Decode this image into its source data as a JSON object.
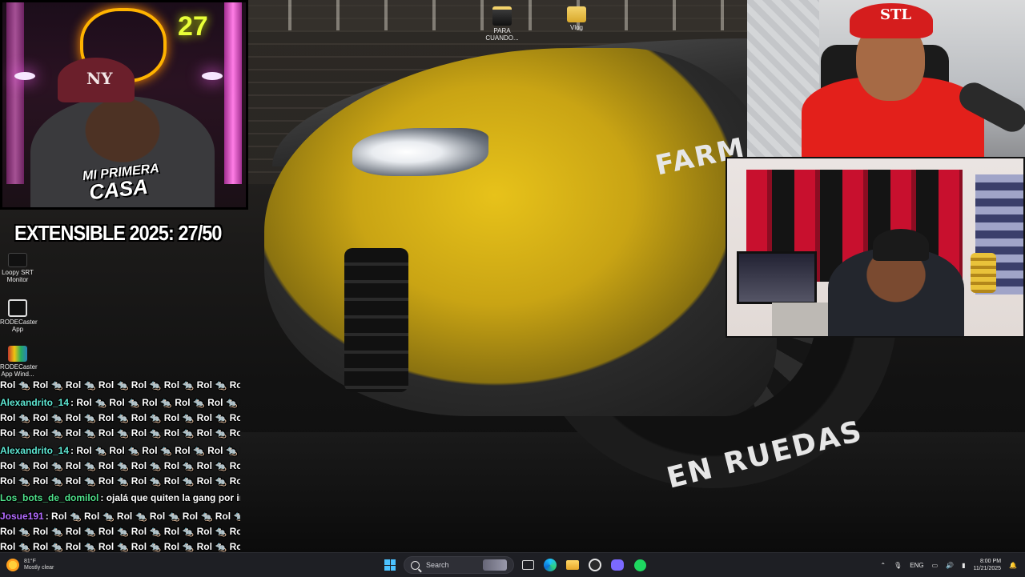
{
  "desktop": {
    "icons": [
      {
        "label": "PARA CUANDO..."
      },
      {
        "label": "Vlog"
      },
      {
        "label": "Loopy SRT Monitor"
      },
      {
        "label": "RODECaster App"
      },
      {
        "label": "RODECaster App Wind..."
      }
    ]
  },
  "overlay": {
    "brand_line1": "MI PRIMERA",
    "brand_line2": "CASA",
    "counter": "EXTENSIBLE 2025: 27/50",
    "cam1_neon": "27",
    "cam1_cap_logo": "NY",
    "cam2_cap_logo": "STL"
  },
  "scene": {
    "tire_top_text": "FARM",
    "tire_bottom_text": "EN RUEDAS"
  },
  "chat": {
    "lines": [
      {
        "user": "",
        "message": "Rol 🐀 Rol 🐀 Rol 🐀 Rol 🐀 Rol 🐀 Rol 🐀 Rol 🐀 Rol 🐀 Ro",
        "color": "#ffffff"
      },
      {
        "user": "Alexandrito_14",
        "message": ": Rol 🐀 Rol 🐀 Rol 🐀 Rol 🐀 Rol 🐀 Rol 🐀 Rol",
        "color": "#5ee6d2"
      },
      {
        "user": "",
        "message": "Rol 🐀 Rol 🐀 Rol 🐀 Rol 🐀 Rol 🐀 Rol 🐀 Rol 🐀 Rol 🐀 Ro",
        "color": "#ffffff"
      },
      {
        "user": "",
        "message": "Rol 🐀 Rol 🐀 Rol 🐀 Rol 🐀 Rol 🐀 Rol 🐀 Rol 🐀 Rol 🐀 Ro",
        "color": "#ffffff"
      },
      {
        "user": "Alexandrito_14",
        "message": ": Rol 🐀 Rol 🐀 Rol 🐀 Rol 🐀 Rol 🐀 Rol 🐀 Rol",
        "color": "#5ee6d2"
      },
      {
        "user": "",
        "message": "Rol 🐀 Rol 🐀 Rol 🐀 Rol 🐀 Rol 🐀 Rol 🐀 Rol 🐀 Rol 🐀 Ro",
        "color": "#ffffff"
      },
      {
        "user": "",
        "message": "Rol 🐀 Rol 🐀 Rol 🐀 Rol 🐀 Rol 🐀 Rol 🐀 Rol 🐀 Rol 🐀 Ro",
        "color": "#ffffff"
      },
      {
        "user": "Los_bots_de_domilol",
        "message": ": ojalá que quiten la gang por in",
        "color": "#4fe08a"
      },
      {
        "user": "Josue191",
        "message": ": Rol 🐀 Rol 🐀 Rol 🐀 Rol 🐀 Rol 🐀 Rol 🐀 Ro",
        "color": "#b46bff"
      },
      {
        "user": "",
        "message": "Rol 🐀 Rol 🐀 Rol 🐀 Rol 🐀 Rol 🐀 Rol 🐀 Rol 🐀 Rol 🐀 Ro",
        "color": "#ffffff"
      },
      {
        "user": "",
        "message": "Rol 🐀 Rol 🐀 Rol 🐀 Rol 🐀 Rol 🐀 Rol 🐀 Rol 🐀 Rol 🐀 Ro",
        "color": "#ffffff"
      }
    ]
  },
  "taskbar": {
    "weather": {
      "temp": "81°F",
      "condition": "Mostly clear"
    },
    "search_placeholder": "Search",
    "apps": [
      "task-view-icon",
      "edge-icon",
      "file-explorer-icon",
      "obs-icon",
      "discord-icon",
      "spotify-icon"
    ],
    "tray": {
      "language": "ENG",
      "time": "8:00 PM",
      "date": "11/21/2025"
    }
  }
}
